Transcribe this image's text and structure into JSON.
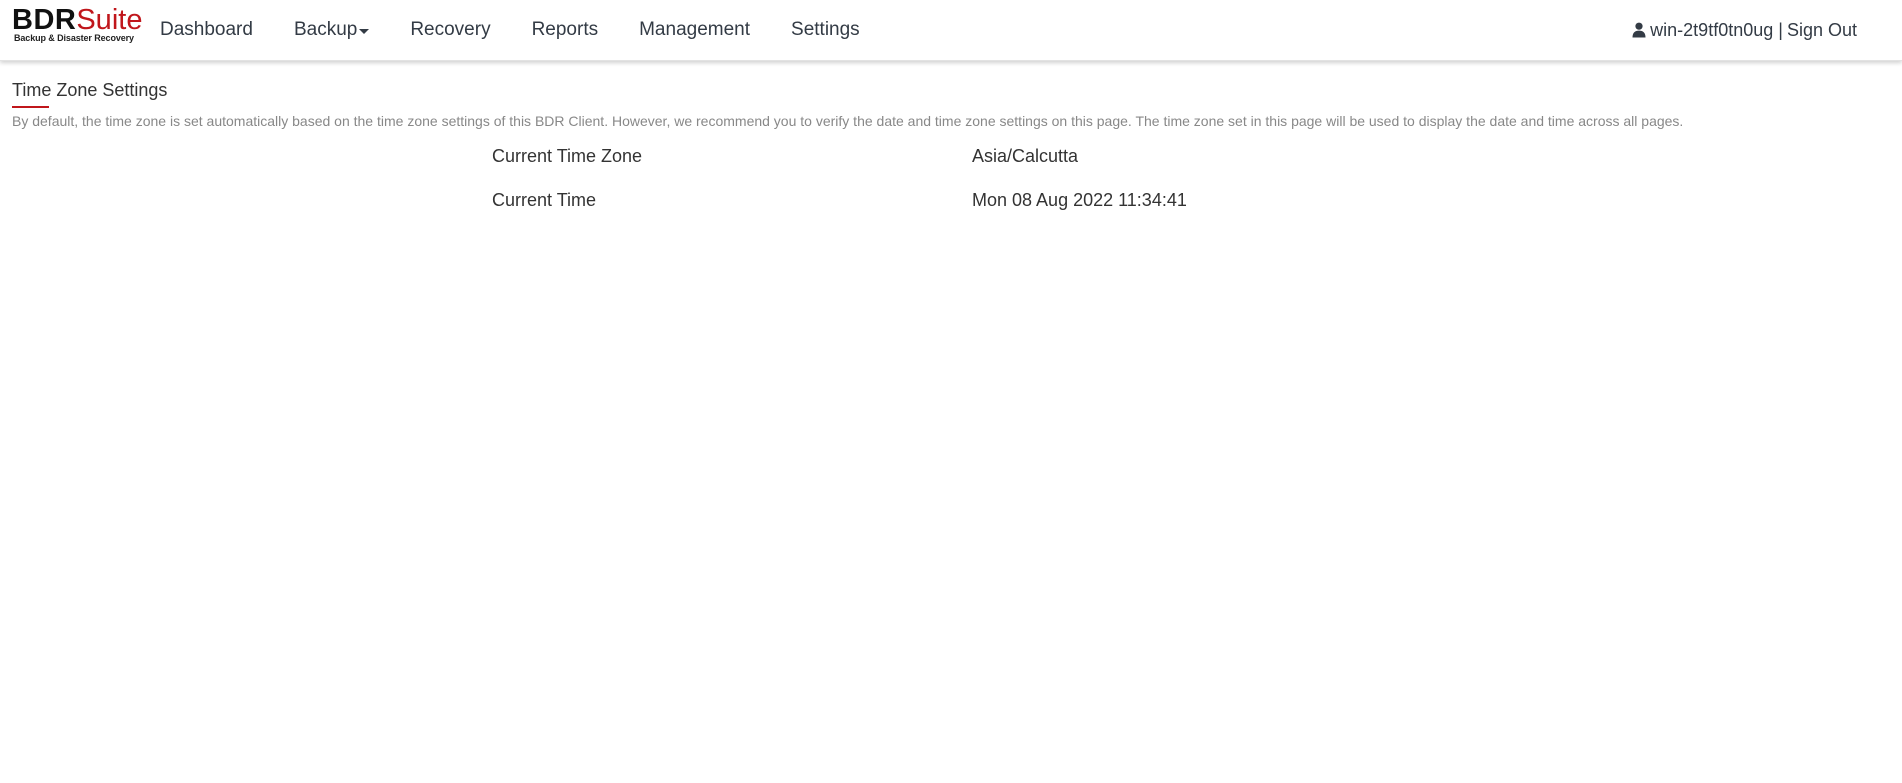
{
  "logo": {
    "brand_primary": "BDR",
    "brand_secondary": "Suite",
    "tagline": "Backup & Disaster Recovery",
    "accent_color": "#c0161b"
  },
  "nav": {
    "items": [
      {
        "label": "Dashboard"
      },
      {
        "label": "Backup",
        "has_dropdown": true
      },
      {
        "label": "Recovery"
      },
      {
        "label": "Reports"
      },
      {
        "label": "Management"
      },
      {
        "label": "Settings"
      }
    ]
  },
  "user": {
    "icon": "user-icon",
    "name": "win-2t9tf0tn0ug",
    "separator": "|",
    "sign_out_label": "Sign Out"
  },
  "page": {
    "title": "Time Zone Settings",
    "description": "By default, the time zone is set automatically based on the time zone settings of this BDR Client. However, we recommend you to verify the date and time zone settings on this page. The time zone set in this page will be used to display the date and time across all pages."
  },
  "settings": {
    "rows": [
      {
        "label": "Current Time Zone",
        "value": "Asia/Calcutta"
      },
      {
        "label": "Current Time",
        "value": "Mon 08 Aug 2022 11:34:41"
      }
    ]
  }
}
